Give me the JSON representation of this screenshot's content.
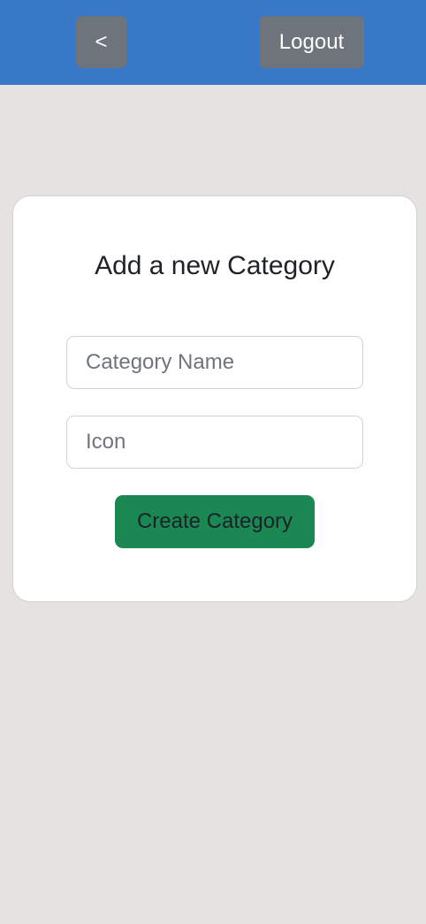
{
  "header": {
    "back_label": "<",
    "logout_label": "Logout"
  },
  "form": {
    "title": "Add a new Category",
    "category_name": {
      "value": "",
      "placeholder": "Category Name"
    },
    "icon": {
      "value": "",
      "placeholder": "Icon"
    },
    "submit_label": "Create Category"
  },
  "colors": {
    "header_bg": "#3779c6",
    "nav_button_bg": "#6d747c",
    "page_bg": "#e4e3e1",
    "primary_button_bg": "#1b8753"
  }
}
